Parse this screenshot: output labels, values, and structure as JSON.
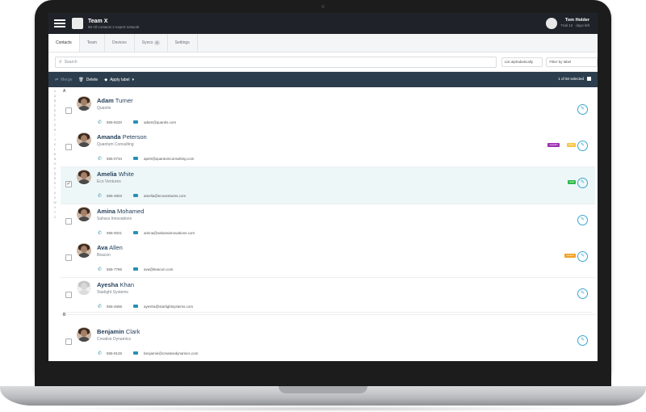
{
  "header": {
    "team_name": "Team X",
    "team_sub": "96 All contacts   2 expert network",
    "user_name": "Tom Holder",
    "user_sub": "Trial 12 · days left"
  },
  "tabs": [
    {
      "label": "Contacts",
      "active": true
    },
    {
      "label": "Team"
    },
    {
      "label": "Devices"
    },
    {
      "label": "Syncs",
      "badge": "0"
    },
    {
      "label": "Settings"
    }
  ],
  "toolbar": {
    "search_placeholder": "Search",
    "sort_label": "List alphabetically",
    "filter_label": "Filter by label"
  },
  "actions": {
    "merge": "Merge",
    "delete": "Delete",
    "apply_label": "Apply label",
    "selection": "1 of 50 selected"
  },
  "alphabet": [
    "#",
    "A",
    "B",
    "C",
    "D",
    "E",
    "F",
    "G",
    "H",
    "I",
    "J",
    "K",
    "L",
    "M",
    "N",
    "O",
    "P",
    "Q",
    "R",
    "S",
    "T",
    "U",
    "V",
    "W",
    "X",
    "Y",
    "Z"
  ],
  "sections": {
    "a": "A",
    "b": "B"
  },
  "contacts": [
    {
      "first": "Adam",
      "last": "Turner",
      "company": "Quantis",
      "phone": "555-9220",
      "email": "adam@quantis.com"
    },
    {
      "first": "Amanda",
      "last": "Peterson",
      "company": "Quantum Consulting",
      "phone": "555-0734",
      "email": "apetr@quantumconsulting.com",
      "tags": [
        {
          "text": "supplier",
          "color": "#9b2fae"
        },
        {
          "text": "client",
          "color": "#f5c542"
        }
      ]
    },
    {
      "first": "Amelia",
      "last": "White",
      "company": "Eco Ventures",
      "phone": "555-4903",
      "email": "amelia@ecoventures.com",
      "selected": true,
      "tags": [
        {
          "text": "lead",
          "color": "#2fb84a"
        }
      ]
    },
    {
      "first": "Amina",
      "last": "Mohamed",
      "company": "Sahara Innovations",
      "phone": "555-0021",
      "email": "amina@saharainnovations.com"
    },
    {
      "first": "Ava",
      "last": "Allen",
      "company": "Beacon",
      "phone": "555-7786",
      "email": "ava@beacon.com",
      "tags": [
        {
          "text": "partner",
          "color": "#f0a020"
        }
      ]
    },
    {
      "first": "Ayesha",
      "last": "Khan",
      "company": "Starlight Systems",
      "phone": "555-4556",
      "email": "ayesha@starlightsystems.com"
    },
    {
      "first": "Benjamin",
      "last": "Clark",
      "company": "Creative Dynamics",
      "phone": "555-9125",
      "email": "benjamin@creativedynamics.com"
    }
  ]
}
